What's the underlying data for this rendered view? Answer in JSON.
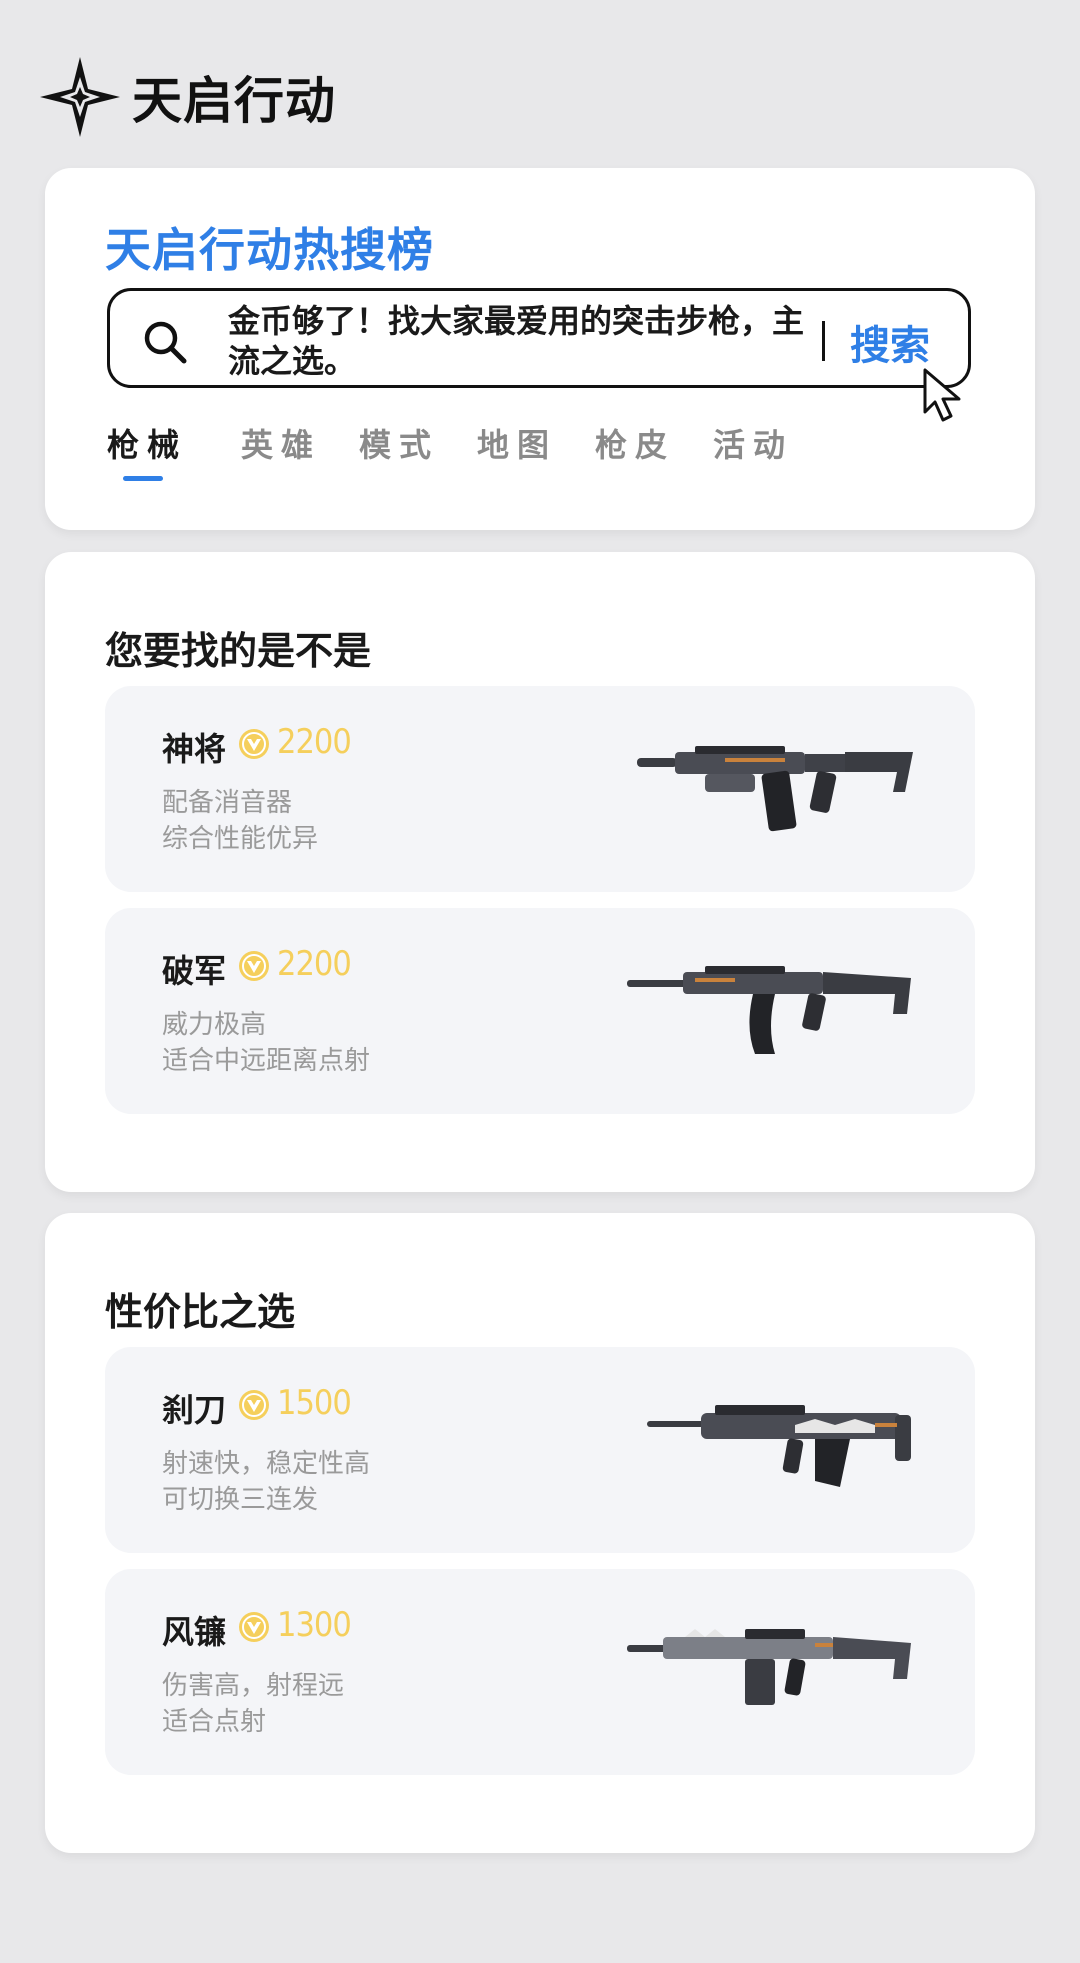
{
  "brand": {
    "name": "天启行动",
    "logo_icon": "star-compass-icon"
  },
  "hot_search": {
    "title": "天启行动热搜榜",
    "query": "金币够了！找大家最爱用的突击步枪，主流之选。",
    "button_label": "搜索",
    "search_icon": "search-icon",
    "cursor_icon": "pointer-cursor-icon"
  },
  "tabs": [
    {
      "label": "枪械",
      "active": true
    },
    {
      "label": "英雄",
      "active": false
    },
    {
      "label": "模式",
      "active": false
    },
    {
      "label": "地图",
      "active": false
    },
    {
      "label": "枪皮",
      "active": false
    },
    {
      "label": "活动",
      "active": false
    }
  ],
  "sections": [
    {
      "title": "您要找的是不是",
      "items": [
        {
          "name": "神将",
          "price": "2200",
          "desc": [
            "配备消音器",
            "综合性能优异"
          ]
        },
        {
          "name": "破军",
          "price": "2200",
          "desc": [
            "威力极高",
            "适合中远距离点射"
          ]
        }
      ]
    },
    {
      "title": "性价比之选",
      "items": [
        {
          "name": "刹刀",
          "price": "1500",
          "desc": [
            "射速快，稳定性高",
            "可切换三连发"
          ]
        },
        {
          "name": "风镰",
          "price": "1300",
          "desc": [
            "伤害高，射程远",
            "适合点射"
          ]
        }
      ]
    }
  ],
  "colors": {
    "accent": "#2f7fe6",
    "price": "#f5cf5c",
    "background": "#e8e8ea",
    "card": "#ffffff",
    "item_bg": "#f4f5f8"
  }
}
